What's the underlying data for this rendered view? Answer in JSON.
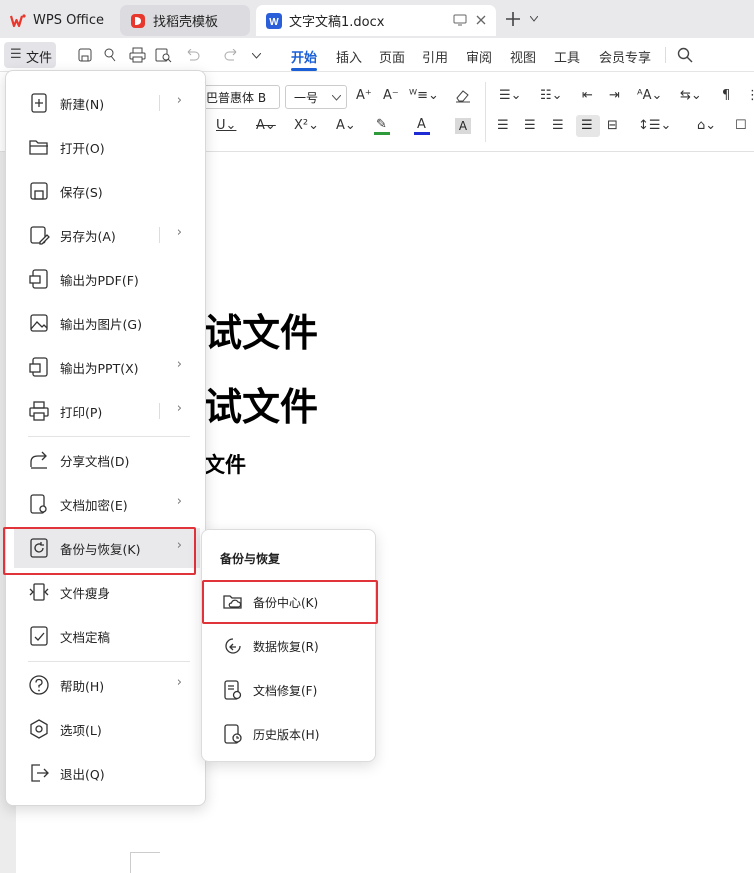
{
  "tabs": {
    "wps": "WPS Office",
    "daoke": "找稻壳模板",
    "doc": "文字文稿1.docx"
  },
  "menu_row": {
    "file": "文件",
    "tabs": [
      "开始",
      "插入",
      "页面",
      "引用",
      "审阅",
      "视图",
      "工具",
      "会员专享"
    ],
    "active_tab": "开始"
  },
  "ribbon": {
    "font_name": "巴普惠体 B",
    "font_size": "一号"
  },
  "document": {
    "line1": "试文件",
    "line2": "试文件",
    "line3": "文件"
  },
  "file_menu": {
    "items": [
      {
        "label": "新建(N)",
        "icon": "new-doc-icon",
        "submenu": true
      },
      {
        "label": "打开(O)",
        "icon": "folder-open-icon",
        "submenu": false
      },
      {
        "label": "保存(S)",
        "icon": "save-icon",
        "submenu": false
      },
      {
        "label": "另存为(A)",
        "icon": "save-as-icon",
        "submenu": true
      },
      {
        "label": "输出为PDF(F)",
        "icon": "pdf-icon",
        "submenu": false
      },
      {
        "label": "输出为图片(G)",
        "icon": "image-icon",
        "submenu": false
      },
      {
        "label": "输出为PPT(X)",
        "icon": "ppt-icon",
        "submenu": true
      },
      {
        "label": "打印(P)",
        "icon": "print-icon",
        "submenu": true
      },
      {
        "label": "分享文档(D)",
        "icon": "share-icon",
        "submenu": false
      },
      {
        "label": "文档加密(E)",
        "icon": "lock-doc-icon",
        "submenu": true
      },
      {
        "label": "备份与恢复(K)",
        "icon": "backup-icon",
        "submenu": true
      },
      {
        "label": "文件瘦身",
        "icon": "slim-icon",
        "submenu": false
      },
      {
        "label": "文档定稿",
        "icon": "finalize-icon",
        "submenu": false
      },
      {
        "label": "帮助(H)",
        "icon": "help-icon",
        "submenu": true
      },
      {
        "label": "选项(L)",
        "icon": "options-icon",
        "submenu": false
      },
      {
        "label": "退出(Q)",
        "icon": "exit-icon",
        "submenu": false
      }
    ]
  },
  "submenu": {
    "title": "备份与恢复",
    "items": [
      {
        "label": "备份中心(K)",
        "icon": "cloud-folder-icon"
      },
      {
        "label": "数据恢复(R)",
        "icon": "restore-icon"
      },
      {
        "label": "文档修复(F)",
        "icon": "repair-icon"
      },
      {
        "label": "历史版本(H)",
        "icon": "history-icon"
      }
    ]
  },
  "colors": {
    "accent": "#1a5fd6",
    "highlight": "#e0343a",
    "wps_red": "#e8382d",
    "word_blue": "#2b5fd9"
  }
}
